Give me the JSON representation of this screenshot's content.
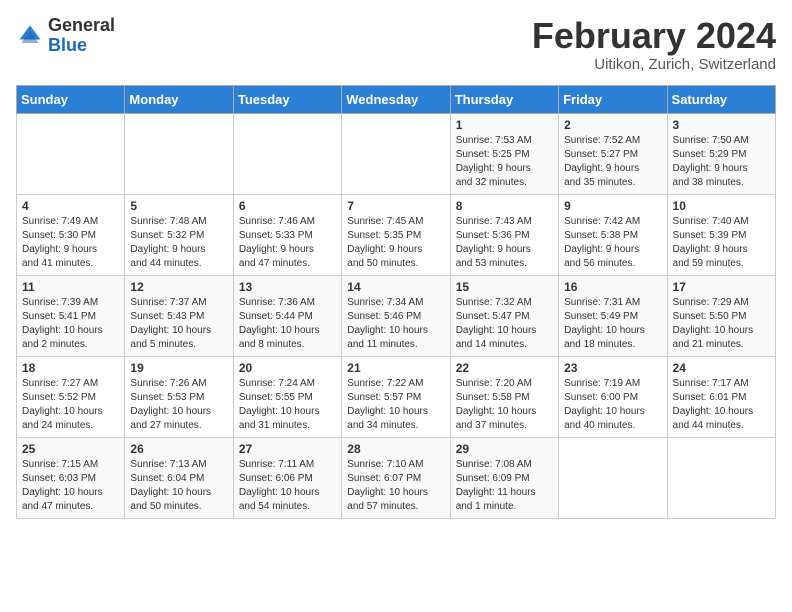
{
  "header": {
    "logo_general": "General",
    "logo_blue": "Blue",
    "month_title": "February 2024",
    "location": "Uitikon, Zurich, Switzerland"
  },
  "days_of_week": [
    "Sunday",
    "Monday",
    "Tuesday",
    "Wednesday",
    "Thursday",
    "Friday",
    "Saturday"
  ],
  "weeks": [
    [
      {
        "day": "",
        "content": ""
      },
      {
        "day": "",
        "content": ""
      },
      {
        "day": "",
        "content": ""
      },
      {
        "day": "",
        "content": ""
      },
      {
        "day": "1",
        "content": "Sunrise: 7:53 AM\nSunset: 5:25 PM\nDaylight: 9 hours\nand 32 minutes."
      },
      {
        "day": "2",
        "content": "Sunrise: 7:52 AM\nSunset: 5:27 PM\nDaylight: 9 hours\nand 35 minutes."
      },
      {
        "day": "3",
        "content": "Sunrise: 7:50 AM\nSunset: 5:29 PM\nDaylight: 9 hours\nand 38 minutes."
      }
    ],
    [
      {
        "day": "4",
        "content": "Sunrise: 7:49 AM\nSunset: 5:30 PM\nDaylight: 9 hours\nand 41 minutes."
      },
      {
        "day": "5",
        "content": "Sunrise: 7:48 AM\nSunset: 5:32 PM\nDaylight: 9 hours\nand 44 minutes."
      },
      {
        "day": "6",
        "content": "Sunrise: 7:46 AM\nSunset: 5:33 PM\nDaylight: 9 hours\nand 47 minutes."
      },
      {
        "day": "7",
        "content": "Sunrise: 7:45 AM\nSunset: 5:35 PM\nDaylight: 9 hours\nand 50 minutes."
      },
      {
        "day": "8",
        "content": "Sunrise: 7:43 AM\nSunset: 5:36 PM\nDaylight: 9 hours\nand 53 minutes."
      },
      {
        "day": "9",
        "content": "Sunrise: 7:42 AM\nSunset: 5:38 PM\nDaylight: 9 hours\nand 56 minutes."
      },
      {
        "day": "10",
        "content": "Sunrise: 7:40 AM\nSunset: 5:39 PM\nDaylight: 9 hours\nand 59 minutes."
      }
    ],
    [
      {
        "day": "11",
        "content": "Sunrise: 7:39 AM\nSunset: 5:41 PM\nDaylight: 10 hours\nand 2 minutes."
      },
      {
        "day": "12",
        "content": "Sunrise: 7:37 AM\nSunset: 5:43 PM\nDaylight: 10 hours\nand 5 minutes."
      },
      {
        "day": "13",
        "content": "Sunrise: 7:36 AM\nSunset: 5:44 PM\nDaylight: 10 hours\nand 8 minutes."
      },
      {
        "day": "14",
        "content": "Sunrise: 7:34 AM\nSunset: 5:46 PM\nDaylight: 10 hours\nand 11 minutes."
      },
      {
        "day": "15",
        "content": "Sunrise: 7:32 AM\nSunset: 5:47 PM\nDaylight: 10 hours\nand 14 minutes."
      },
      {
        "day": "16",
        "content": "Sunrise: 7:31 AM\nSunset: 5:49 PM\nDaylight: 10 hours\nand 18 minutes."
      },
      {
        "day": "17",
        "content": "Sunrise: 7:29 AM\nSunset: 5:50 PM\nDaylight: 10 hours\nand 21 minutes."
      }
    ],
    [
      {
        "day": "18",
        "content": "Sunrise: 7:27 AM\nSunset: 5:52 PM\nDaylight: 10 hours\nand 24 minutes."
      },
      {
        "day": "19",
        "content": "Sunrise: 7:26 AM\nSunset: 5:53 PM\nDaylight: 10 hours\nand 27 minutes."
      },
      {
        "day": "20",
        "content": "Sunrise: 7:24 AM\nSunset: 5:55 PM\nDaylight: 10 hours\nand 31 minutes."
      },
      {
        "day": "21",
        "content": "Sunrise: 7:22 AM\nSunset: 5:57 PM\nDaylight: 10 hours\nand 34 minutes."
      },
      {
        "day": "22",
        "content": "Sunrise: 7:20 AM\nSunset: 5:58 PM\nDaylight: 10 hours\nand 37 minutes."
      },
      {
        "day": "23",
        "content": "Sunrise: 7:19 AM\nSunset: 6:00 PM\nDaylight: 10 hours\nand 40 minutes."
      },
      {
        "day": "24",
        "content": "Sunrise: 7:17 AM\nSunset: 6:01 PM\nDaylight: 10 hours\nand 44 minutes."
      }
    ],
    [
      {
        "day": "25",
        "content": "Sunrise: 7:15 AM\nSunset: 6:03 PM\nDaylight: 10 hours\nand 47 minutes."
      },
      {
        "day": "26",
        "content": "Sunrise: 7:13 AM\nSunset: 6:04 PM\nDaylight: 10 hours\nand 50 minutes."
      },
      {
        "day": "27",
        "content": "Sunrise: 7:11 AM\nSunset: 6:06 PM\nDaylight: 10 hours\nand 54 minutes."
      },
      {
        "day": "28",
        "content": "Sunrise: 7:10 AM\nSunset: 6:07 PM\nDaylight: 10 hours\nand 57 minutes."
      },
      {
        "day": "29",
        "content": "Sunrise: 7:08 AM\nSunset: 6:09 PM\nDaylight: 11 hours\nand 1 minute."
      },
      {
        "day": "",
        "content": ""
      },
      {
        "day": "",
        "content": ""
      }
    ]
  ]
}
